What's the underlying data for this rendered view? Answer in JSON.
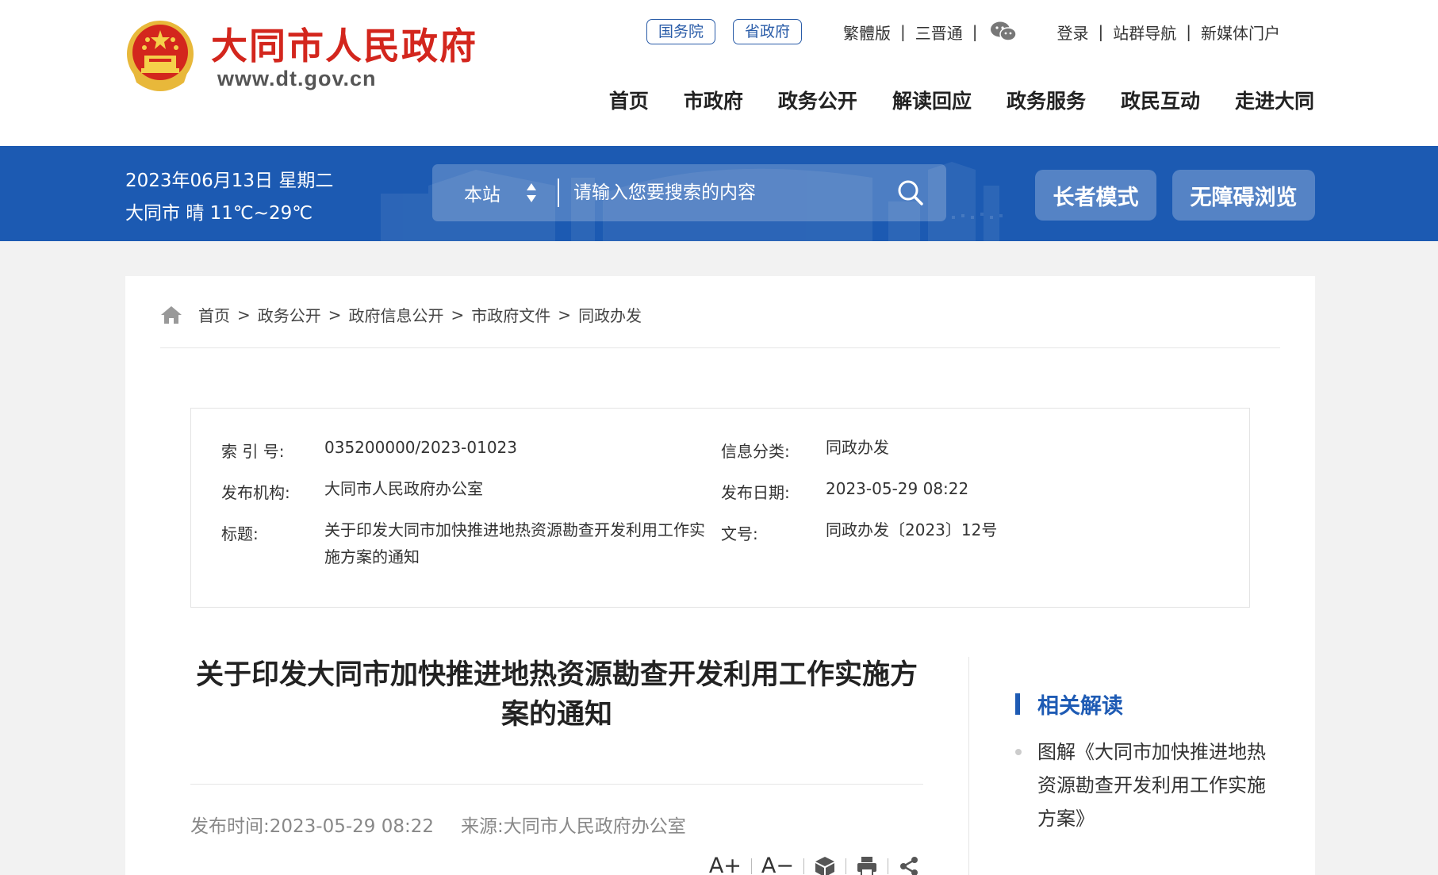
{
  "header": {
    "site_name": "大同市人民政府",
    "site_url": "www.dt.gov.cn",
    "top_pills": [
      "国务院",
      "省政府"
    ],
    "top_links_left": [
      "繁體版",
      "三晋通"
    ],
    "top_links_right": [
      "登录",
      "站群导航",
      "新媒体门户"
    ],
    "separator": "|",
    "nav": [
      "首页",
      "市政府",
      "政务公开",
      "解读回应",
      "政务服务",
      "政民互动",
      "走进大同"
    ]
  },
  "bar": {
    "date": "2023年06月13日 星期二",
    "weather": "大同市 晴 11℃~29℃",
    "search_scope": "本站",
    "search_placeholder": "请输入您要搜索的内容",
    "elder_mode": "长者模式",
    "accessible": "无障碍浏览"
  },
  "breadcrumb": {
    "items": [
      "首页",
      "政务公开",
      "政府信息公开",
      "市政府文件",
      "同政办发"
    ],
    "separator": ">"
  },
  "info": {
    "index_label": "索 引 号:",
    "index_value": "035200000/2023-01023",
    "category_label": "信息分类:",
    "category_value": "同政办发",
    "org_label": "发布机构:",
    "org_value": "大同市人民政府办公室",
    "date_label": "发布日期:",
    "date_value": "2023-05-29 08:22",
    "title_label": "标题:",
    "title_value": "关于印发大同市加快推进地热资源勘查开发利用工作实施方案的通知",
    "docno_label": "文号:",
    "docno_value": "同政办发〔2023〕12号"
  },
  "article": {
    "title": "关于印发大同市加快推进地热资源勘查开发利用工作实施方案的通知",
    "publish_time": "发布时间:2023-05-29 08:22",
    "source": "来源:大同市人民政府办公室",
    "font_up": "A+",
    "font_down": "A−"
  },
  "sidebar": {
    "heading": "相关解读",
    "items": [
      "图解《大同市加快推进地热资源勘查开发利用工作实施方案》"
    ]
  },
  "colors": {
    "brand_red": "#d3261d",
    "brand_blue": "#1c5ab2",
    "link_blue": "#1e5bb4"
  }
}
